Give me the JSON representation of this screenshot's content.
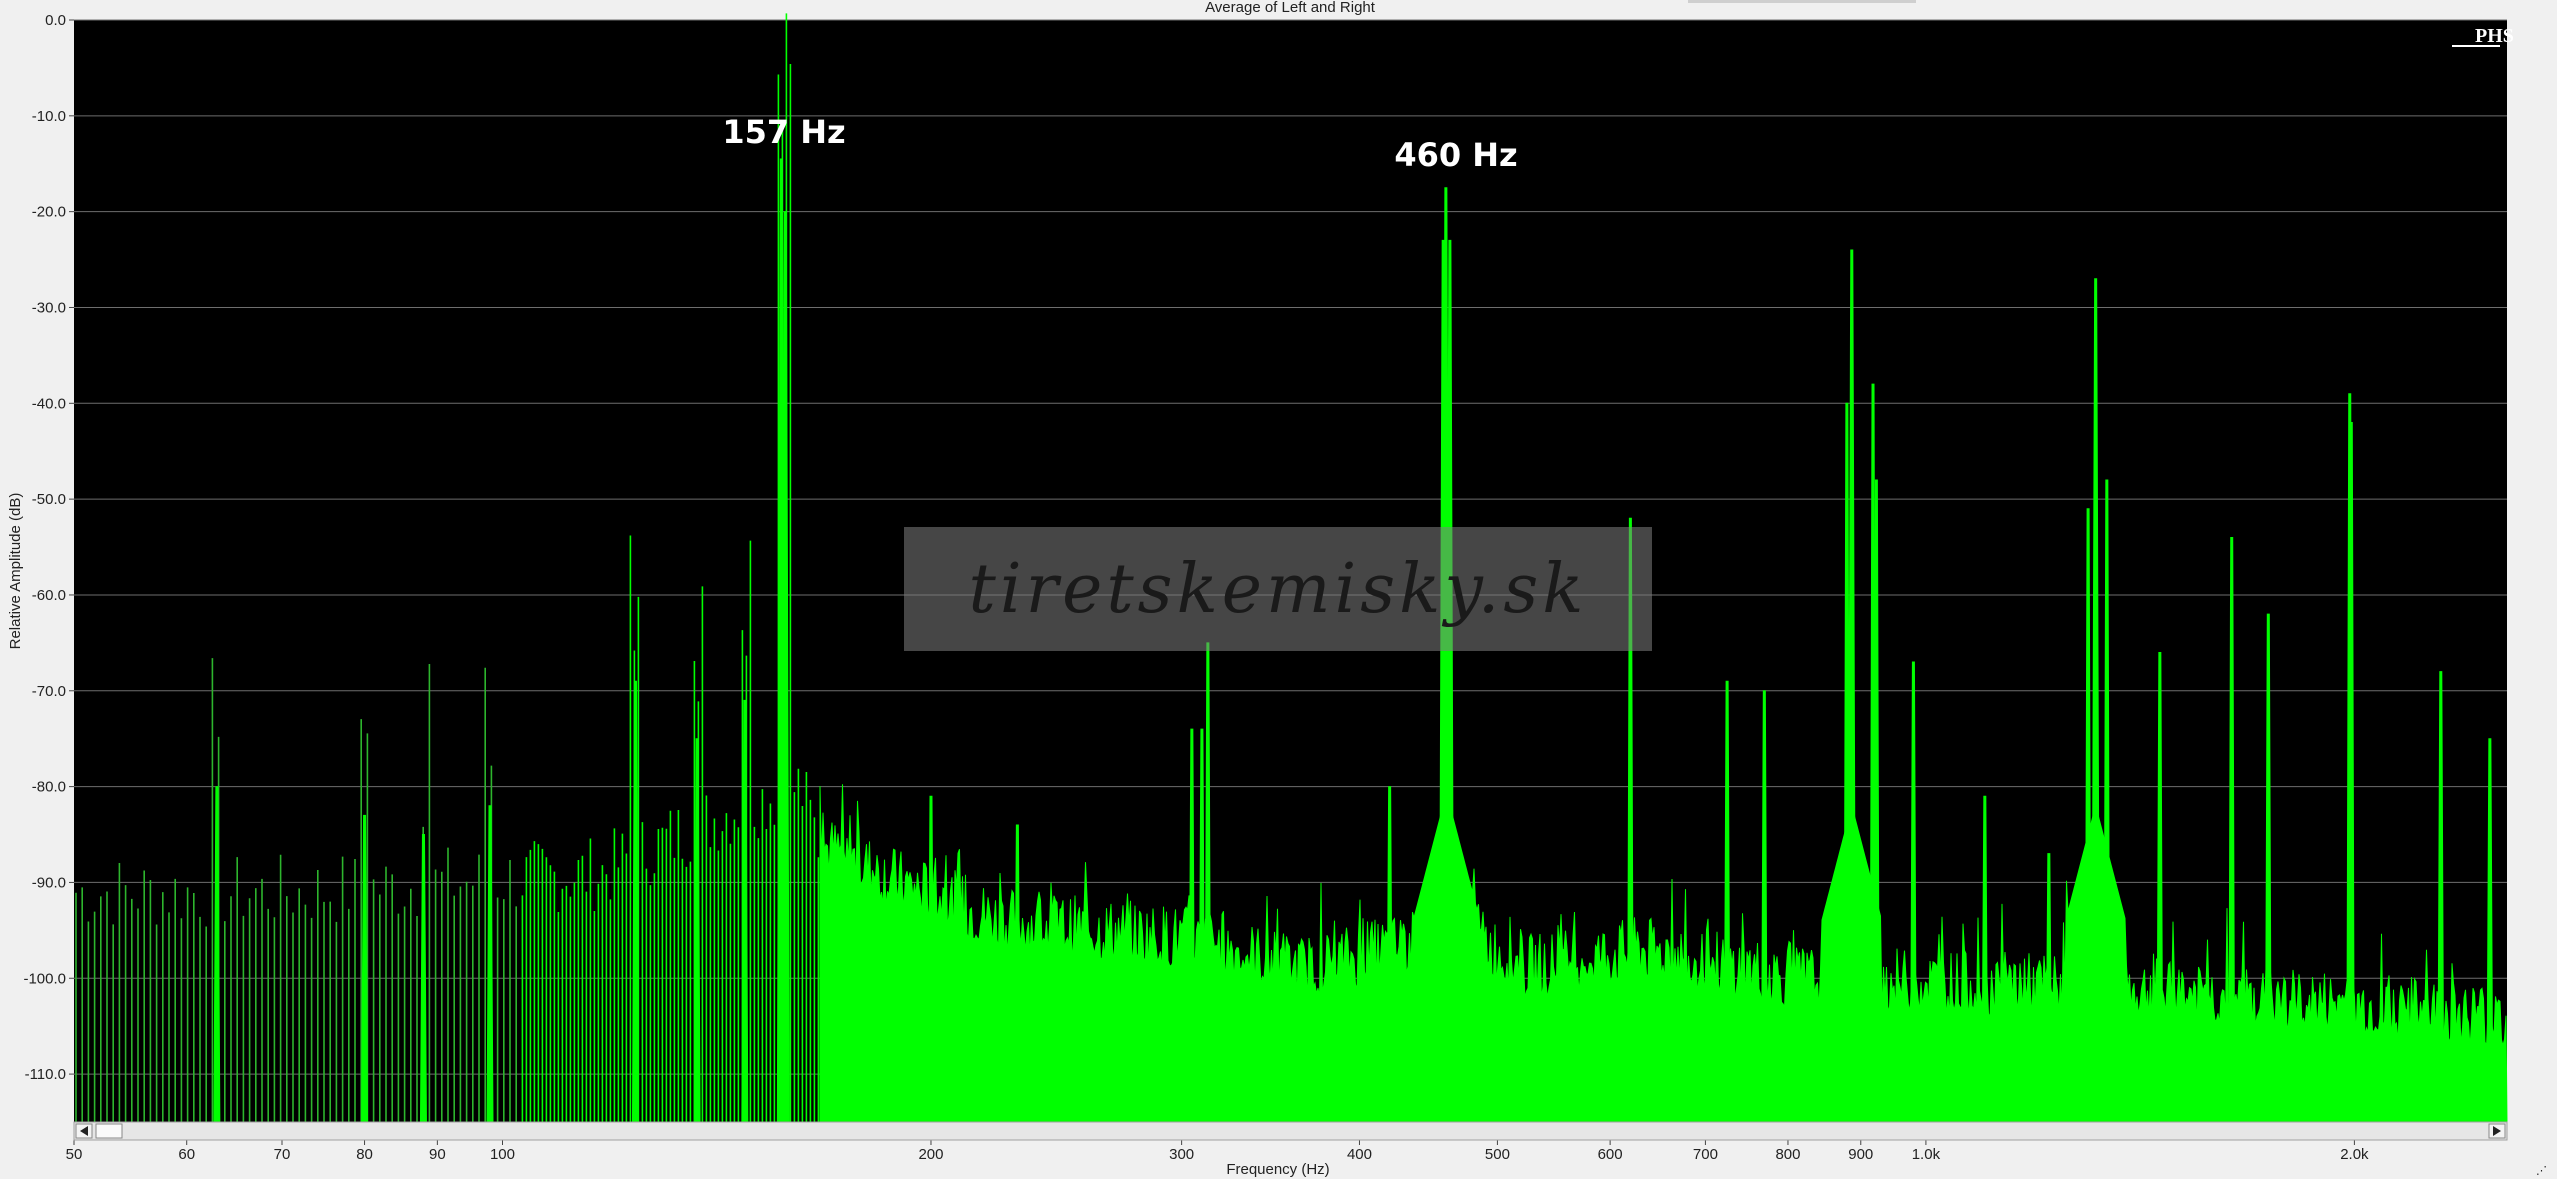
{
  "chart_data": {
    "type": "area",
    "title": "Average of Left and Right",
    "xlabel": "Frequency (Hz)",
    "ylabel": "Relative Amplitude (dB)",
    "xscale": "log",
    "xlim": [
      50,
      2560
    ],
    "ylim": [
      -115,
      0
    ],
    "grid": true,
    "background_color": "#000000",
    "series_color": "#00ff00",
    "y_ticks": [
      "0.0",
      "-10.0",
      "-20.0",
      "-30.0",
      "-40.0",
      "-50.0",
      "-60.0",
      "-70.0",
      "-80.0",
      "-90.0",
      "-100.0",
      "-110.0"
    ],
    "x_ticks": [
      {
        "value": 50,
        "label": "50"
      },
      {
        "value": 60,
        "label": "60"
      },
      {
        "value": 70,
        "label": "70"
      },
      {
        "value": 80,
        "label": "80"
      },
      {
        "value": 90,
        "label": "90"
      },
      {
        "value": 100,
        "label": "100"
      },
      {
        "value": 200,
        "label": "200"
      },
      {
        "value": 300,
        "label": "300"
      },
      {
        "value": 400,
        "label": "400"
      },
      {
        "value": 500,
        "label": "500"
      },
      {
        "value": 600,
        "label": "600"
      },
      {
        "value": 700,
        "label": "700"
      },
      {
        "value": 800,
        "label": "800"
      },
      {
        "value": 900,
        "label": "900"
      },
      {
        "value": 1000,
        "label": "1.0k"
      },
      {
        "value": 2000,
        "label": "2.0k"
      }
    ],
    "peaks": [
      {
        "x": 63,
        "y": -80
      },
      {
        "x": 80,
        "y": -83
      },
      {
        "x": 88,
        "y": -85
      },
      {
        "x": 98,
        "y": -82
      },
      {
        "x": 124,
        "y": -69
      },
      {
        "x": 137,
        "y": -75
      },
      {
        "x": 148,
        "y": -71
      },
      {
        "x": 157,
        "y": -14.5
      },
      {
        "x": 158,
        "y": -20
      },
      {
        "x": 200,
        "y": -81
      },
      {
        "x": 230,
        "y": -84
      },
      {
        "x": 305,
        "y": -74
      },
      {
        "x": 310,
        "y": -74
      },
      {
        "x": 313,
        "y": -65
      },
      {
        "x": 420,
        "y": -80
      },
      {
        "x": 458,
        "y": -23
      },
      {
        "x": 460,
        "y": -17.5
      },
      {
        "x": 463,
        "y": -23
      },
      {
        "x": 620,
        "y": -52
      },
      {
        "x": 725,
        "y": -69
      },
      {
        "x": 770,
        "y": -70
      },
      {
        "x": 880,
        "y": -40
      },
      {
        "x": 887,
        "y": -24
      },
      {
        "x": 918,
        "y": -38
      },
      {
        "x": 923,
        "y": -48
      },
      {
        "x": 980,
        "y": -67
      },
      {
        "x": 1100,
        "y": -81
      },
      {
        "x": 1220,
        "y": -87
      },
      {
        "x": 1300,
        "y": -51
      },
      {
        "x": 1316,
        "y": -27
      },
      {
        "x": 1340,
        "y": -48
      },
      {
        "x": 1460,
        "y": -66
      },
      {
        "x": 1640,
        "y": -54
      },
      {
        "x": 1740,
        "y": -62
      },
      {
        "x": 1985,
        "y": -39
      },
      {
        "x": 1990,
        "y": -42
      },
      {
        "x": 2300,
        "y": -68
      },
      {
        "x": 2490,
        "y": -75
      }
    ],
    "annotations": [
      "157 Hz",
      "460 Hz"
    ]
  },
  "badge": "PHS",
  "watermark": "tiretskemisky.sk"
}
